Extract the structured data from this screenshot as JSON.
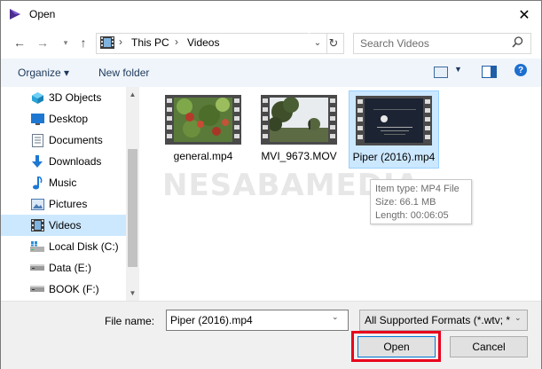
{
  "window": {
    "title": "Open",
    "close_icon": "close-icon"
  },
  "nav": {
    "address": {
      "items": [
        "This PC",
        "Videos"
      ],
      "icon": "videos-folder-icon"
    },
    "search": {
      "placeholder": "Search Videos"
    }
  },
  "toolbar": {
    "organize_label": "Organize ▾",
    "new_folder_label": "New folder"
  },
  "sidebar": {
    "items": [
      {
        "label": "3D Objects",
        "icon": "cube-icon",
        "color": "#29a3d6"
      },
      {
        "label": "Desktop",
        "icon": "desktop-icon",
        "color": "#1e78d2"
      },
      {
        "label": "Documents",
        "icon": "documents-icon",
        "color": "#6b7a8c"
      },
      {
        "label": "Downloads",
        "icon": "download-icon",
        "color": "#1e78d2"
      },
      {
        "label": "Music",
        "icon": "music-icon",
        "color": "#1e78d2"
      },
      {
        "label": "Pictures",
        "icon": "pictures-icon",
        "color": "#4a7ab2"
      },
      {
        "label": "Videos",
        "icon": "videos-icon",
        "color": "#4a4a4a",
        "selected": true
      },
      {
        "label": "Local Disk (C:)",
        "icon": "windows-drive-icon",
        "color": "#2d8fd6"
      },
      {
        "label": "Data (E:)",
        "icon": "drive-icon",
        "color": "#555555"
      },
      {
        "label": "BOOK (F:)",
        "icon": "drive-icon",
        "color": "#555555"
      }
    ]
  },
  "files": [
    {
      "name": "general.mp4",
      "thumb": "plants"
    },
    {
      "name": "MVI_9673.MOV",
      "thumb": "trees"
    },
    {
      "name": "Piper (2016).mp4",
      "thumb": "pixar",
      "selected": true
    }
  ],
  "watermark": "NESABAMEDIA",
  "tooltip": {
    "type": "Item type: MP4 File",
    "size": "Size: 66.1 MB",
    "length": "Length: 00:06:05"
  },
  "footer": {
    "filename_label": "File name:",
    "filename_value": "Piper (2016).mp4",
    "filetype_value": "All Supported Formats (*.wtv; *",
    "open_label": "Open",
    "cancel_label": "Cancel"
  },
  "colors": {
    "accent": "#0078d7",
    "highlight": "#e8001c",
    "selection": "#cce8ff"
  }
}
